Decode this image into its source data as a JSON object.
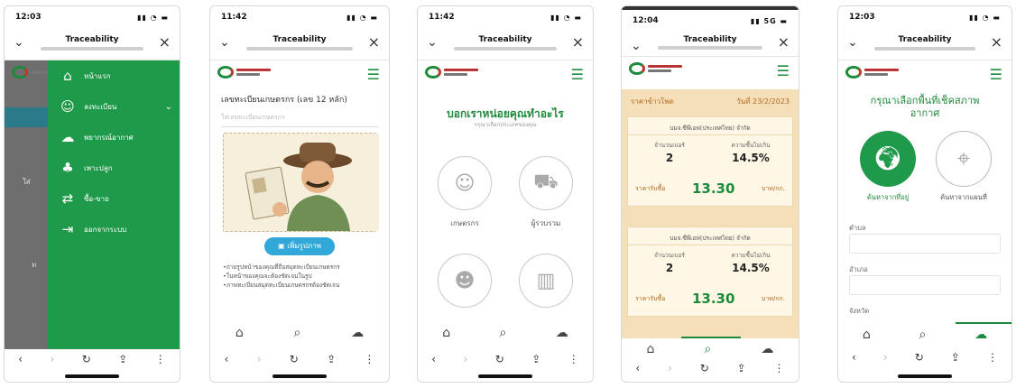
{
  "phones": [
    {
      "time": "12:03",
      "browser_title": "Traceability",
      "menu": [
        {
          "icon": "home-icon",
          "glyph": "⌂",
          "label": "หน้าแรก"
        },
        {
          "icon": "farmer-icon",
          "glyph": "☺",
          "label": "ลงทะเบียน"
        },
        {
          "icon": "weather-icon",
          "glyph": "☁",
          "label": "พยากรณ์อากาศ"
        },
        {
          "icon": "crop-icon",
          "glyph": "♣",
          "label": "เพาะปลูก"
        },
        {
          "icon": "trade-icon",
          "glyph": "⇄",
          "label": "ซื้อ-ขาย"
        },
        {
          "icon": "logout-icon",
          "glyph": "⇥",
          "label": "ออกจากระบบ"
        }
      ]
    },
    {
      "time": "11:42",
      "browser_title": "Traceability",
      "id_label": "เลขทะเบียนเกษตรกร (เลข 12 หลัก)",
      "id_placeholder": "ใส่เลขทะเบียนเกษตรกร",
      "add_photo_button": "เพิ่มรูปภาพ",
      "bullets": [
        "ถ่ายรูปหน้าของคุณที่ถือสมุดทะเบียนเกษตรกร",
        "ในหน้าของคุณจะต้องชัดเจนในรูป",
        "ภาพทะเบียนสมุดทะเบียนเกษตรกรต้องชัดเจน"
      ]
    },
    {
      "time": "11:42",
      "browser_title": "Traceability",
      "heading": "บอกเราหน่อยคุณทำอะไร",
      "subheading": "กรุณาเลือกประเภทของคุณ",
      "roles": [
        {
          "icon": "farmer-role-icon",
          "label": "เกษตรกร"
        },
        {
          "icon": "collector-role-icon",
          "label": "ผู้รวบรวม"
        },
        {
          "icon": "trader-role-icon",
          "label": ""
        },
        {
          "icon": "factory-role-icon",
          "label": ""
        }
      ]
    },
    {
      "time": "12:04",
      "browser_title": "Traceability",
      "header_left": "ราคาข้าวโพด",
      "header_right": "วันที่ 23/2/2023",
      "cards": [
        {
          "title": "บมจ.ซีพีเอฟ(ประเทศไทย) จำกัด",
          "left_label": "จำนวนเบอร์",
          "left_value": "2",
          "right_label": "ความชื้นไม่เกิน",
          "right_value": "14.5%",
          "price_label": "ราคารับซื้อ",
          "price": "13.30",
          "unit": "บาท/กก."
        },
        {
          "title": "บมจ.ซีพีเอฟ(ประเทศไทย) จำกัด",
          "left_label": "จำนวนเบอร์",
          "left_value": "2",
          "right_label": "ความชื้นไม่เกิน",
          "right_value": "14.5%",
          "price_label": "ราคารับซื้อ",
          "price": "13.30",
          "unit": "บาท/กก."
        }
      ]
    },
    {
      "time": "12:03",
      "browser_title": "Traceability",
      "heading": "กรุณาเลือกพื้นที่เช็คสภาพอากาศ",
      "option_current": "ค้นหาจากที่อยู่",
      "option_map": "ค้นหาจากแผนที่",
      "field_1": "ตำบล",
      "field_2": "อำเภอ",
      "field_3": "จังหวัด"
    }
  ],
  "tabbar": [
    "home-icon",
    "search-icon",
    "weather-icon"
  ],
  "colors": {
    "brand_green": "#1e8a3c",
    "drawer_green": "#1f9a4b",
    "accent_blue": "#32a8d8",
    "price_bg": "#f4dfb8"
  }
}
